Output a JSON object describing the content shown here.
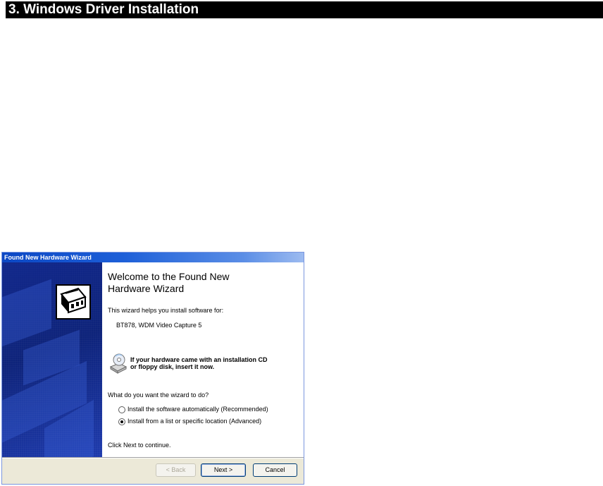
{
  "section": {
    "title": "3. Windows Driver Installation"
  },
  "wizard": {
    "window_title": "Found New Hardware Wizard",
    "heading_line1": "Welcome to the Found New",
    "heading_line2": "Hardware Wizard",
    "intro": "This wizard helps you install software for:",
    "device_name": "BT878, WDM Video Capture 5",
    "cd_prompt_line1": "If your hardware came with an installation CD",
    "cd_prompt_line2": "or floppy disk, insert it now.",
    "question": "What do you want the wizard to do?",
    "options": [
      {
        "label": "Install the software automatically (Recommended)",
        "selected": false
      },
      {
        "label": "Install from a list or specific location (Advanced)",
        "selected": true
      }
    ],
    "continue_hint": "Click Next to continue.",
    "buttons": {
      "back": "< Back",
      "next": "Next >",
      "cancel": "Cancel"
    },
    "colors": {
      "titlebar": "#0b47c4",
      "banner": "#122d8c",
      "dialog_face": "#ece9d8"
    },
    "icons": {
      "hardware": "hardware-wizard-icon",
      "cd": "cd-drive-icon"
    }
  }
}
